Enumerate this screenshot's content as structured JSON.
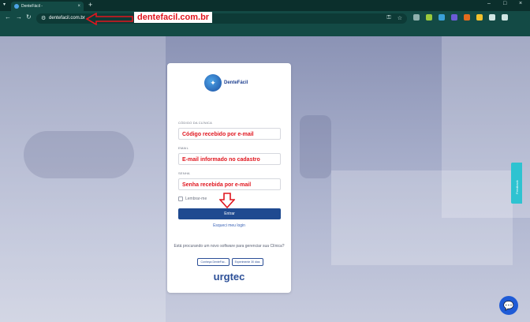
{
  "browser": {
    "tab_title": "DenteFácil -",
    "tab_close": "×",
    "new_tab": "+",
    "url": "dentefacil.com.br",
    "min": "–",
    "max": "□",
    "close": "×"
  },
  "annotations": {
    "url_label": "dentefacil.com.br"
  },
  "login": {
    "brand": "DenteFácil",
    "clinic_code_label": "CÓDIGO DA CLÍNICA",
    "clinic_code_value": "Código recebido por e-mail",
    "email_label": "EMAIL",
    "email_value": "E-mail informado no cadastro",
    "password_label": "SENHA",
    "password_value": "Senha recebida por e-mail",
    "remember_label": "Lembrar-me",
    "submit_label": "Entrar",
    "forgot_label": "Esqueci meu login",
    "promo_text": "Está procurando um novo software para gerenciar sua Clínica?",
    "btn_know": "Conheça DenteFác..",
    "btn_trial": "Experimente 30 dias",
    "company": "urgtec"
  },
  "feedback_label": "Feedback",
  "colors": {
    "accent": "#1f4a90",
    "annotation": "#e0161f",
    "chrome": "#134a45"
  },
  "icons": {
    "chat": "chat-bubble-icon",
    "back": "back-arrow-icon",
    "forward": "forward-arrow-icon",
    "reload": "reload-icon"
  }
}
